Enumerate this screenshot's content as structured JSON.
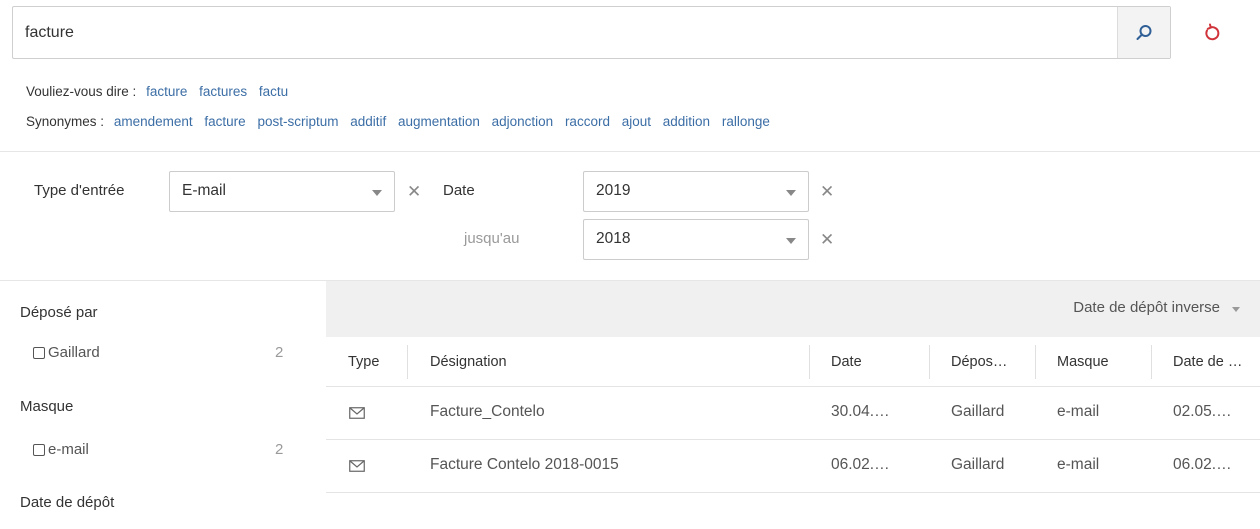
{
  "search": {
    "value": "facture",
    "placeholder": ""
  },
  "suggestions": {
    "did_you_mean_label": "Vouliez-vous dire :",
    "did_you_mean": [
      "facture",
      "factures",
      "factu"
    ],
    "synonyms_label": "Synonymes :",
    "synonyms": [
      "amendement",
      "facture",
      "post-scriptum",
      "additif",
      "augmentation",
      "adjonction",
      "raccord",
      "ajout",
      "addition",
      "rallonge"
    ]
  },
  "filters": {
    "entry_type_label": "Type d'entrée",
    "entry_type_value": "E-mail",
    "date_label": "Date",
    "date_from": "2019",
    "until_label": "jusqu'au",
    "date_to": "2018"
  },
  "facets": {
    "deposited_by_title": "Déposé par",
    "deposited_by": [
      {
        "label": "Gaillard",
        "count": "2"
      }
    ],
    "mask_title": "Masque",
    "mask": [
      {
        "label": "e-mail",
        "count": "2"
      }
    ],
    "deposit_date_title": "Date de dépôt"
  },
  "results": {
    "sort_label": "Date de dépôt inverse",
    "columns": [
      "Type",
      "Désignation",
      "Date",
      "Dépos…",
      "Masque",
      "Date de …"
    ],
    "rows": [
      {
        "type_icon": "envelope-icon",
        "name": "Facture_Contelo",
        "date": "30.04.…",
        "deposited_by": "Gaillard",
        "mask": "e-mail",
        "deposit_date": "02.05.…"
      },
      {
        "type_icon": "envelope-icon",
        "name": "Facture Contelo 2018-0015",
        "date": "06.02.…",
        "deposited_by": "Gaillard",
        "mask": "e-mail",
        "deposit_date": "06.02.…"
      }
    ]
  },
  "colors": {
    "accent_link": "#3c6ea6",
    "reset_icon": "#d0343a",
    "search_icon": "#2f5f96"
  }
}
